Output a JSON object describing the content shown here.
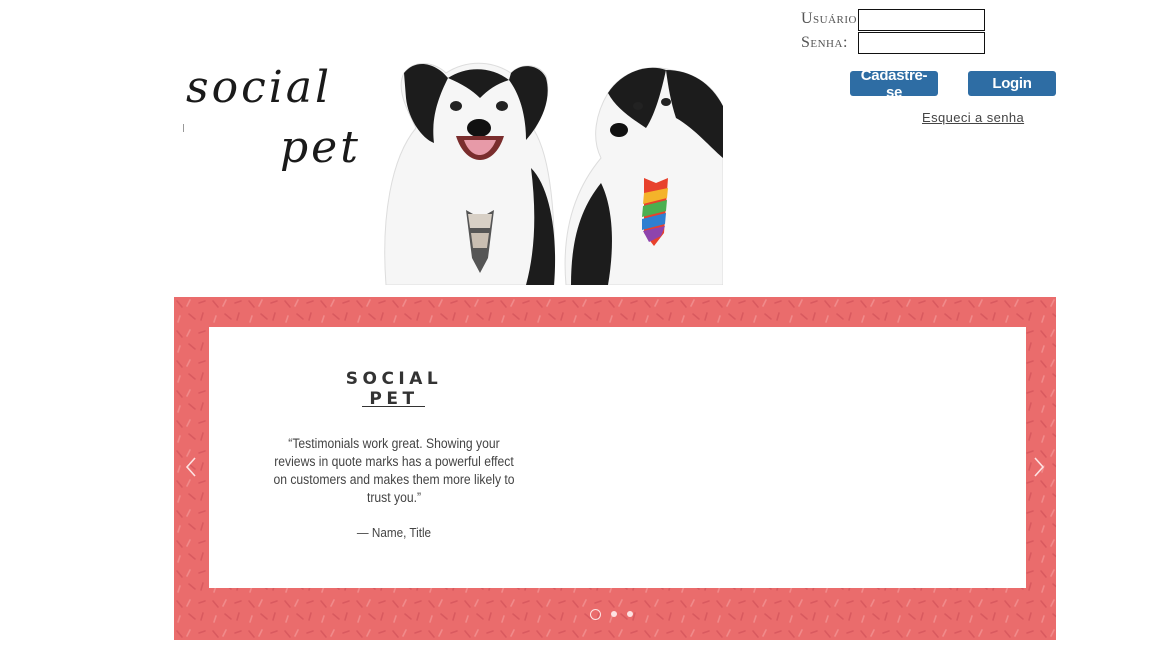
{
  "brand": {
    "line1": "social",
    "line2": "pet"
  },
  "login": {
    "user_label": "Usuário:",
    "pass_label": "Senha:",
    "user_value": "",
    "pass_value": "",
    "signup_label": "Cadastre-se",
    "login_label": "Login",
    "forgot_label": "Esqueci a senha"
  },
  "colors": {
    "button": "#2e6da4",
    "slider_background": "#ea6c6c"
  },
  "slide": {
    "title": "SOCIAL PET",
    "quote": "“Testimonials work great. Showing your reviews in quote marks has a powerful effect on customers and makes them more likely to trust you.”",
    "author": "— Name, Title"
  },
  "slider_nav": {
    "prev_icon": "chevron-left-icon",
    "next_icon": "chevron-right-icon",
    "dot_count": 3,
    "active_dot": 1
  },
  "hero_image": {
    "description_icon": "dogs-photo"
  }
}
